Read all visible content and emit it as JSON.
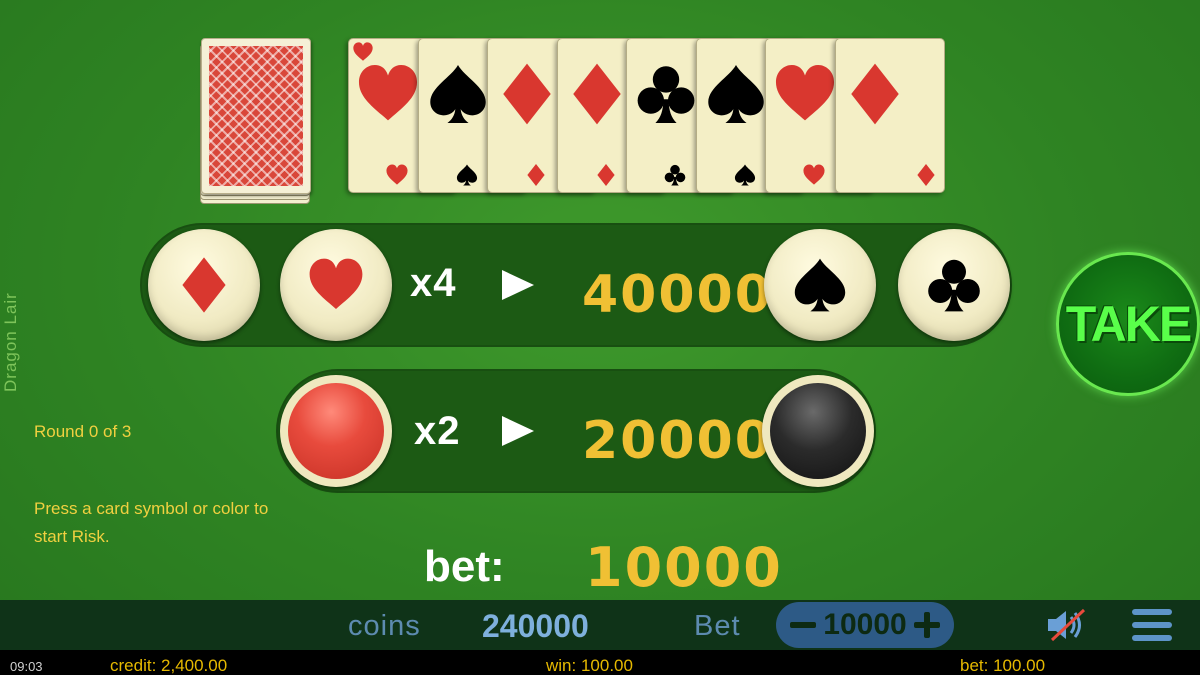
{
  "side": {
    "title": "Dragon Lair",
    "round_text": "Round 0 of 3",
    "hint_text": "Press a card symbol or color to start Risk."
  },
  "history_cards": [
    {
      "suit": "hearts",
      "color": "#d9372f"
    },
    {
      "suit": "spades",
      "color": "#000000"
    },
    {
      "suit": "diamonds",
      "color": "#d9372f"
    },
    {
      "suit": "diamonds",
      "color": "#d9372f"
    },
    {
      "suit": "clubs",
      "color": "#000000"
    },
    {
      "suit": "spades",
      "color": "#000000"
    },
    {
      "suit": "hearts",
      "color": "#d9372f"
    },
    {
      "suit": "diamonds",
      "color": "#d9372f"
    }
  ],
  "suit_bet": {
    "multiplier": "x4",
    "prize": "40000",
    "buttons": [
      "diamonds",
      "hearts",
      "spades",
      "clubs"
    ]
  },
  "color_bet": {
    "multiplier": "x2",
    "prize": "20000",
    "buttons": [
      "red",
      "black"
    ]
  },
  "take_label": "TAKE",
  "bet": {
    "label": "bet:",
    "value": "10000"
  },
  "bottom_bar": {
    "coins_label": "coins",
    "coins_value": "240000",
    "bet_label": "Bet",
    "bet_value": "10000",
    "sound_icon": "speaker-muted-icon",
    "menu_icon": "hamburger-menu-icon"
  },
  "status_line": {
    "time": "09:03",
    "credit": "credit: 2,400.00",
    "win": "win: 100.00",
    "bet": "bet: 100.00"
  },
  "colors": {
    "felt": "#2f8423",
    "panel": "#1c5a14",
    "prize_gold": "#f0c034",
    "red_suit": "#d9372f",
    "take_green": "#59ff4a",
    "bar_bg": "#0f3318",
    "bar_text": "#7eb0dc"
  }
}
